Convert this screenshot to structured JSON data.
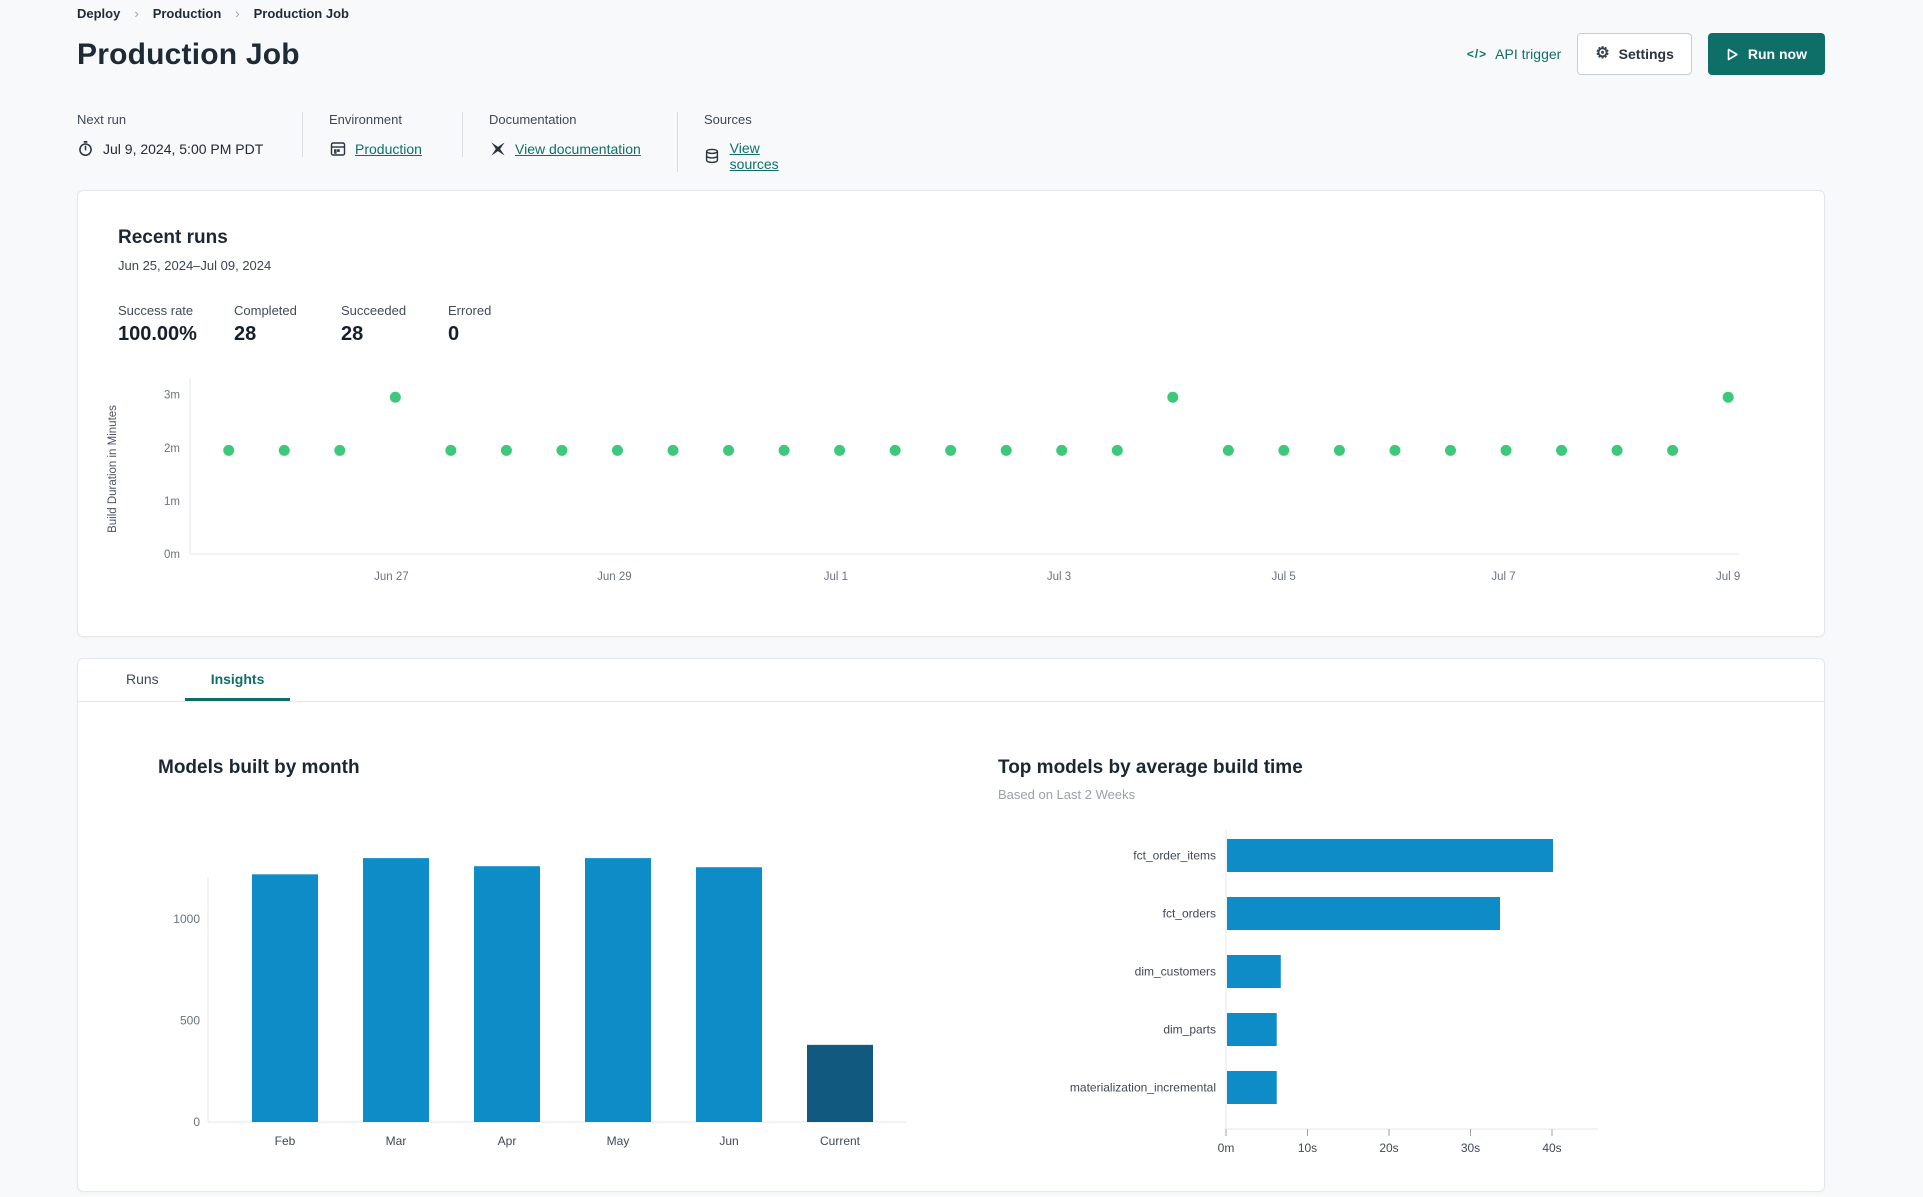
{
  "breadcrumb": {
    "separator": "›",
    "items": [
      {
        "label": "Deploy"
      },
      {
        "label": "Production"
      },
      {
        "label": "Production Job"
      }
    ]
  },
  "header": {
    "title": "Production Job",
    "api_icon": "</>",
    "api_trigger_label": "API trigger",
    "settings_icon": "⚙",
    "settings_label": "Settings",
    "run_now_label": "Run now"
  },
  "meta": {
    "next_run": {
      "label": "Next run",
      "value": "Jul 9, 2024, 5:00 PM PDT"
    },
    "environment": {
      "label": "Environment",
      "value": "Production"
    },
    "documentation": {
      "label": "Documentation",
      "value": "View documentation"
    },
    "sources": {
      "label": "Sources",
      "value": "View sources"
    }
  },
  "recent_runs": {
    "title": "Recent runs",
    "date_range": "Jun 25, 2024–Jul 09, 2024",
    "stats": [
      {
        "label": "Success rate",
        "value": "100.00%"
      },
      {
        "label": "Completed",
        "value": "28"
      },
      {
        "label": "Succeeded",
        "value": "28"
      },
      {
        "label": "Errored",
        "value": "0"
      }
    ]
  },
  "tabs": [
    {
      "label": "Runs",
      "active": false
    },
    {
      "label": "Insights",
      "active": true
    }
  ],
  "colors": {
    "accent_teal": "#0e6f68",
    "dot_green": "#3dc87c",
    "bar_blue": "#0d8cc7",
    "bar_dark": "#11597e",
    "axis_line": "#e3e7ec",
    "tick_text": "#6a7380",
    "cat_text": "#3f4956"
  },
  "chart_data": [
    {
      "type": "scatter",
      "title": "Recent runs build duration",
      "ylabel": "Build Duration in Minutes",
      "ylim": [
        0,
        3.2
      ],
      "y_ticks": [
        {
          "value": 0,
          "label": "0m"
        },
        {
          "value": 1,
          "label": "1m"
        },
        {
          "value": 2,
          "label": "2m"
        },
        {
          "value": 3,
          "label": "3m"
        }
      ],
      "x_tick_labels": [
        "Jun 27",
        "Jun 29",
        "Jul 1",
        "Jul 3",
        "Jul 5",
        "Jul 7",
        "Jul 9"
      ],
      "x_tick_fracs": [
        0.13,
        0.274,
        0.417,
        0.561,
        0.706,
        0.848,
        0.993
      ],
      "duration_minutes": [
        1.95,
        1.95,
        1.95,
        2.95,
        1.95,
        1.95,
        1.95,
        1.95,
        1.95,
        1.95,
        1.95,
        1.95,
        1.95,
        1.95,
        1.95,
        1.95,
        1.95,
        2.95,
        1.95,
        1.95,
        1.95,
        1.95,
        1.95,
        1.95,
        1.95,
        1.95,
        1.95,
        2.95
      ],
      "grid": false,
      "legend": "none"
    },
    {
      "type": "bar",
      "title": "Models built by month",
      "categories": [
        "Feb",
        "Mar",
        "Apr",
        "May",
        "Jun",
        "Current"
      ],
      "values": [
        1220,
        1300,
        1260,
        1300,
        1255,
        380
      ],
      "y_ticks": [
        0,
        500,
        1000
      ],
      "ylim": [
        0,
        1450
      ],
      "highlight_last": true,
      "grid": false,
      "legend": "none"
    },
    {
      "type": "bar_horizontal",
      "title": "Top models by average build time",
      "subtitle": "Based on Last 2 Weeks",
      "categories": [
        "fct_order_items",
        "fct_orders",
        "dim_customers",
        "dim_parts",
        "materialization_incremental"
      ],
      "values_seconds": [
        40,
        33.5,
        6.6,
        6.1,
        6.1
      ],
      "x_ticks": [
        {
          "value": 0,
          "label": "0m"
        },
        {
          "value": 10,
          "label": "10s"
        },
        {
          "value": 20,
          "label": "20s"
        },
        {
          "value": 30,
          "label": "30s"
        },
        {
          "value": 40,
          "label": "40s"
        }
      ],
      "xlim": [
        0,
        44
      ],
      "grid": false,
      "legend": "none"
    }
  ]
}
